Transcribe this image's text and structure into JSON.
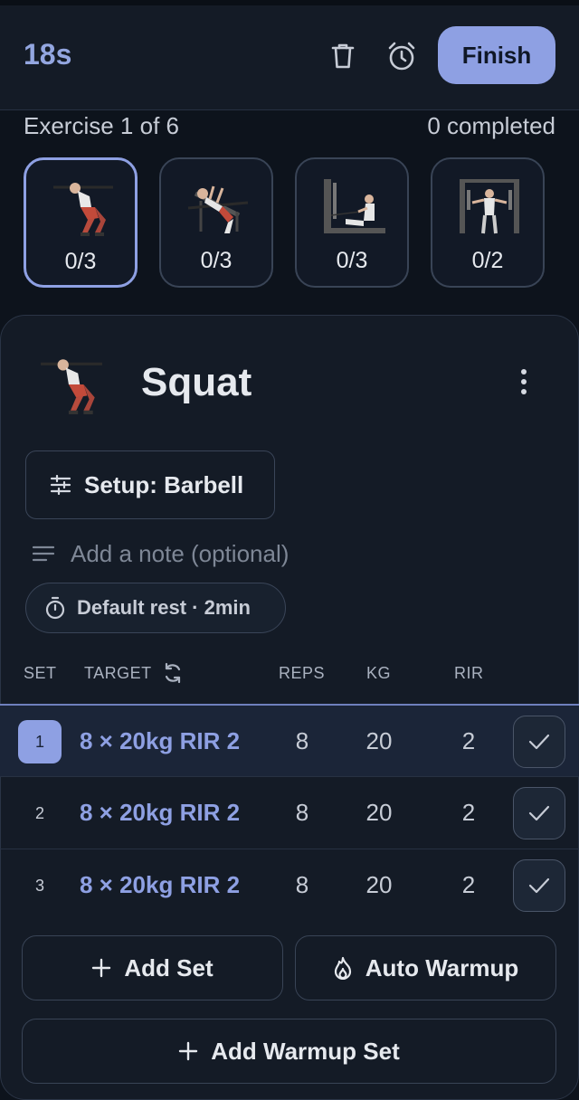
{
  "header": {
    "timer": "18s",
    "finish_label": "Finish",
    "icons": [
      "trash-icon",
      "alarm-clock-icon"
    ]
  },
  "progress": {
    "exercise_position": "Exercise 1 of 6",
    "completed": "0 completed"
  },
  "exercises": [
    {
      "count": "0/3",
      "image": "squat-figure",
      "active": true
    },
    {
      "count": "0/3",
      "image": "incline-bench-press-figure",
      "active": false
    },
    {
      "count": "0/3",
      "image": "seated-cable-row-figure",
      "active": false
    },
    {
      "count": "0/2",
      "image": "cable-crossover-figure",
      "active": false
    }
  ],
  "current": {
    "title": "Squat",
    "setup_label": "Setup: Barbell",
    "note_placeholder": "Add a note (optional)",
    "rest_label": "Default rest · 2min"
  },
  "table": {
    "headers": {
      "set": "SET",
      "target": "TARGET",
      "reps": "REPS",
      "kg": "KG",
      "rir": "RIR"
    },
    "rows": [
      {
        "set": "1",
        "target": "8 × 20kg RIR 2",
        "reps": "8",
        "kg": "20",
        "rir": "2",
        "active": true
      },
      {
        "set": "2",
        "target": "8 × 20kg RIR 2",
        "reps": "8",
        "kg": "20",
        "rir": "2",
        "active": false
      },
      {
        "set": "3",
        "target": "8 × 20kg RIR 2",
        "reps": "8",
        "kg": "20",
        "rir": "2",
        "active": false
      }
    ]
  },
  "actions": {
    "add_set": "Add Set",
    "auto_warmup": "Auto Warmup",
    "add_warmup_set": "Add Warmup Set"
  },
  "colors": {
    "accent": "#8ea0e3",
    "background": "#0d131c",
    "card": "#141b26"
  }
}
